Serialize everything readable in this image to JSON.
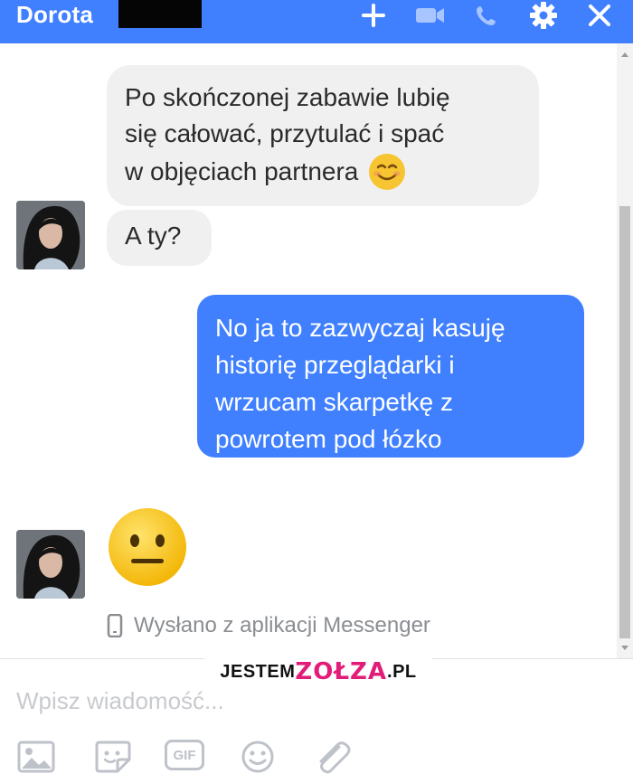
{
  "header": {
    "contact_name": "Dorota",
    "accent_color": "#4080ff",
    "icons": [
      "plus-icon",
      "video-icon",
      "phone-icon",
      "gear-icon",
      "close-icon"
    ]
  },
  "messages": {
    "incoming_1": {
      "lines": [
        "Po skończonej zabawie lubię",
        "się całować, przytulać i spać",
        "w objęciach partnera"
      ],
      "emoji": "smiling-face-emoji"
    },
    "incoming_2": {
      "text": "A ty?"
    },
    "outgoing_1": {
      "lines": [
        "No ja to zazwyczaj kasuję",
        "historię przeglądarki i",
        "wrzucam skarpetkę z",
        "powrotem pod łózko"
      ]
    },
    "incoming_3": {
      "emoji": "neutral-face-emoji"
    }
  },
  "sent_via": "Wysłano z aplikacji Messenger",
  "watermark": {
    "prefix": "JESTEM",
    "brand": "ZOŁZA",
    "suffix": ".PL"
  },
  "composer": {
    "placeholder": "Wpisz wiadomość...",
    "tools": [
      "image-icon",
      "sticker-icon",
      "gif-icon",
      "emoji-icon",
      "attachment-icon"
    ],
    "gif_label": "GIF"
  }
}
